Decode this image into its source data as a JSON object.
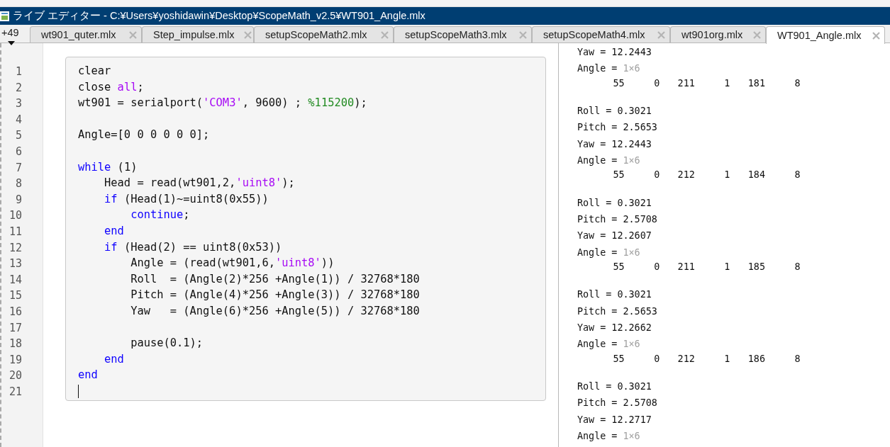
{
  "window": {
    "title": "ライブ エディター - C:¥Users¥yoshidawin¥Desktop¥ScopeMath_v2.5¥WT901_Angle.mlx"
  },
  "tab_overflow": {
    "label": "+49"
  },
  "tabs": [
    {
      "label": "wt901_quter.mlx",
      "selected": false
    },
    {
      "label": "Step_impulse.mlx",
      "selected": false
    },
    {
      "label": "setupScopeMath2.mlx",
      "selected": false
    },
    {
      "label": "setupScopeMath3.mlx",
      "selected": false
    },
    {
      "label": "setupScopeMath4.mlx",
      "selected": false
    },
    {
      "label": "wt901org.mlx",
      "selected": false
    },
    {
      "label": "WT901_Angle.mlx",
      "selected": true
    }
  ],
  "code": {
    "lines": [
      {
        "number": "1",
        "segments": [
          {
            "kind": "plain",
            "text": "clear"
          }
        ]
      },
      {
        "number": "2",
        "segments": [
          {
            "kind": "plain",
            "text": "close "
          },
          {
            "kind": "string",
            "text": "all"
          },
          {
            "kind": "plain",
            "text": ";"
          }
        ]
      },
      {
        "number": "3",
        "segments": [
          {
            "kind": "plain",
            "text": "wt901 = serialport("
          },
          {
            "kind": "string",
            "text": "'COM3'"
          },
          {
            "kind": "plain",
            "text": ", 9600) ; "
          },
          {
            "kind": "comment",
            "text": "%115200"
          },
          {
            "kind": "plain",
            "text": ");"
          }
        ]
      },
      {
        "number": "4"
      },
      {
        "number": "5",
        "segments": [
          {
            "kind": "plain",
            "text": "Angle=[0 0 0 0 0 0];"
          }
        ]
      },
      {
        "number": "6"
      },
      {
        "number": "7",
        "segments": [
          {
            "kind": "keyword",
            "text": "while"
          },
          {
            "kind": "plain",
            "text": " (1)"
          }
        ]
      },
      {
        "number": "8",
        "segments": [
          {
            "kind": "plain",
            "text": "    Head = read(wt901,2,"
          },
          {
            "kind": "string",
            "text": "'uint8'"
          },
          {
            "kind": "plain",
            "text": ");"
          }
        ]
      },
      {
        "number": "9",
        "segments": [
          {
            "kind": "keyword",
            "text": "    if"
          },
          {
            "kind": "plain",
            "text": " (Head(1)~=uint8(0x55))"
          }
        ]
      },
      {
        "number": "10",
        "segments": [
          {
            "kind": "keyword",
            "text": "        continue"
          },
          {
            "kind": "plain",
            "text": ";"
          }
        ]
      },
      {
        "number": "11",
        "segments": [
          {
            "kind": "keyword",
            "text": "    end"
          }
        ]
      },
      {
        "number": "12",
        "segments": [
          {
            "kind": "keyword",
            "text": "    if"
          },
          {
            "kind": "plain",
            "text": " (Head(2) == uint8(0x53))"
          }
        ]
      },
      {
        "number": "13",
        "segments": [
          {
            "kind": "plain",
            "text": "        Angle = (read(wt901,6,"
          },
          {
            "kind": "string",
            "text": "'uint8'"
          },
          {
            "kind": "plain",
            "text": "))"
          }
        ]
      },
      {
        "number": "14",
        "segments": [
          {
            "kind": "plain",
            "text": "        Roll  = (Angle(2)*256 +Angle(1)) / 32768*180"
          }
        ]
      },
      {
        "number": "15",
        "segments": [
          {
            "kind": "plain",
            "text": "        Pitch = (Angle(4)*256 +Angle(3)) / 32768*180"
          }
        ]
      },
      {
        "number": "16",
        "segments": [
          {
            "kind": "plain",
            "text": "        Yaw   = (Angle(6)*256 +Angle(5)) / 32768*180"
          }
        ]
      },
      {
        "number": "17"
      },
      {
        "number": "18",
        "segments": [
          {
            "kind": "plain",
            "text": "        pause(0.1);"
          }
        ]
      },
      {
        "number": "19",
        "segments": [
          {
            "kind": "keyword",
            "text": "    end"
          }
        ]
      },
      {
        "number": "20",
        "segments": [
          {
            "kind": "keyword",
            "text": "end"
          }
        ]
      },
      {
        "number": "21",
        "cursor": true
      }
    ]
  },
  "output": {
    "blocks": [
      {
        "lines": [
          {
            "kind": "var",
            "text": "Yaw = 12.2443"
          },
          {
            "kind": "var",
            "text": "Angle = ",
            "size": "1×6"
          },
          {
            "kind": "row",
            "values": [
              "55",
              "0",
              "211",
              "1",
              "181",
              "8"
            ]
          }
        ]
      },
      {
        "lines": [
          {
            "kind": "var",
            "text": "Roll = 0.3021"
          },
          {
            "kind": "var",
            "text": "Pitch = 2.5653"
          },
          {
            "kind": "var",
            "text": "Yaw = 12.2443"
          },
          {
            "kind": "var",
            "text": "Angle = ",
            "size": "1×6"
          },
          {
            "kind": "row",
            "values": [
              "55",
              "0",
              "212",
              "1",
              "184",
              "8"
            ]
          }
        ]
      },
      {
        "lines": [
          {
            "kind": "var",
            "text": "Roll = 0.3021"
          },
          {
            "kind": "var",
            "text": "Pitch = 2.5708"
          },
          {
            "kind": "var",
            "text": "Yaw = 12.2607"
          },
          {
            "kind": "var",
            "text": "Angle = ",
            "size": "1×6"
          },
          {
            "kind": "row",
            "values": [
              "55",
              "0",
              "211",
              "1",
              "185",
              "8"
            ]
          }
        ]
      },
      {
        "lines": [
          {
            "kind": "var",
            "text": "Roll = 0.3021"
          },
          {
            "kind": "var",
            "text": "Pitch = 2.5653"
          },
          {
            "kind": "var",
            "text": "Yaw = 12.2662"
          },
          {
            "kind": "var",
            "text": "Angle = ",
            "size": "1×6"
          },
          {
            "kind": "row",
            "values": [
              "55",
              "0",
              "212",
              "1",
              "186",
              "8"
            ]
          }
        ]
      },
      {
        "lines": [
          {
            "kind": "var",
            "text": "Roll = 0.3021"
          },
          {
            "kind": "var",
            "text": "Pitch = 2.5708"
          },
          {
            "kind": "var",
            "text": "Yaw = 12.2717"
          },
          {
            "kind": "var",
            "text": "Angle = ",
            "size": "1×6"
          }
        ]
      }
    ]
  }
}
